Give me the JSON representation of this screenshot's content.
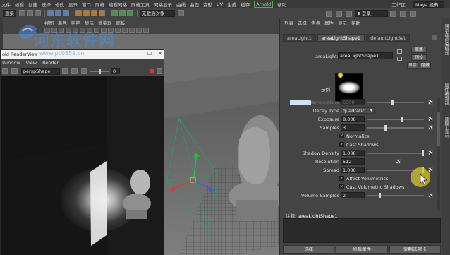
{
  "menubar": {
    "items": [
      "文件",
      "编辑",
      "创建",
      "选择",
      "修改",
      "显示",
      "窗口",
      "网格",
      "编辑网格",
      "网格工具",
      "网格显示",
      "曲线",
      "曲面",
      "变形",
      "UV",
      "生成",
      "缓存",
      "Arnold",
      "帮助"
    ],
    "workspace_label": "工作区:",
    "workspace_value": "Maya 经典"
  },
  "toolbar": {
    "mode_select": "渲染",
    "no_object_field": "无激活对象",
    "login": "登录"
  },
  "viewport": {
    "menu": [
      "视图",
      "着色",
      "照明",
      "显示",
      "渲染器",
      "面板"
    ]
  },
  "render_view": {
    "title": "old RenderView",
    "menu": [
      "Window",
      "View",
      "Render"
    ],
    "camera_select": "perspShape",
    "frame_value": "0"
  },
  "attribute_editor": {
    "menu": [
      "列表",
      "选择",
      "焦点",
      "属性",
      "显示",
      "帮助"
    ],
    "tabs": [
      "areaLight1",
      "areaLightShape1",
      "defaultLightSet"
    ],
    "active_tab": 1,
    "name_label": "areaLight:",
    "name_value": "areaLightShape1",
    "btn_focus": "聚集",
    "btn_preset": "预设",
    "btn_show": "显示",
    "btn_hide": "隐藏",
    "swatch_label": "示例",
    "rows": [
      {
        "type": "slider",
        "label": "Temperature",
        "value": "6500",
        "dim": true,
        "knob": 0.05
      },
      {
        "type": "dropdown",
        "label": "Decay Type",
        "value": "quadratic"
      },
      {
        "type": "slider",
        "label": "Exposure",
        "value": "8.000",
        "knob": 0.6
      },
      {
        "type": "slider",
        "label": "Samples",
        "value": "3",
        "knob": 0.3
      },
      {
        "type": "check",
        "label": "Normalize",
        "checked": true
      },
      {
        "type": "check",
        "label": "Cast Shadows",
        "checked": true
      },
      {
        "type": "slider",
        "label": "Shadow Density",
        "value": "1.000",
        "knob": 1.0
      },
      {
        "type": "plain",
        "label": "Resolution",
        "value": "512"
      },
      {
        "type": "slider",
        "label": "Spread",
        "value": "1.000",
        "knob": 1.0
      },
      {
        "type": "check",
        "label": "Affect Volumetrics",
        "checked": true
      },
      {
        "type": "check",
        "label": "Cast Volumetric Shadows",
        "checked": true
      },
      {
        "type": "slider",
        "label": "Volume Samples",
        "value": "2",
        "knob": 0.2
      }
    ],
    "notes_label": "注释:",
    "notes_name": "areaLightShape1",
    "footer": [
      "选择",
      "加载属性",
      "复制选项卡"
    ]
  },
  "side_tabs": [
    "通道盒/层编辑器",
    "属性编辑器",
    "建模工具包"
  ],
  "watermark": {
    "text": "河东软件网",
    "url": "www.pc0359.cn"
  },
  "colors": {
    "accent": "#5fa35f",
    "highlight": "#d6c428",
    "manipulator_green": "#23a36b"
  }
}
